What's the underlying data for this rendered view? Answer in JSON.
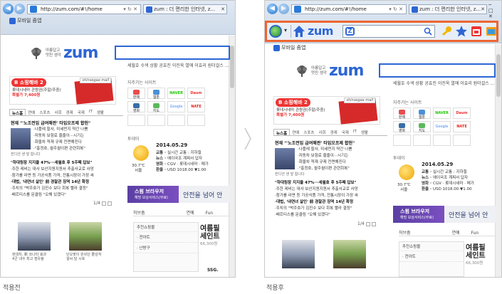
{
  "arrow_icon": "chevron-right-icon",
  "before": {
    "caption": "적용전",
    "address": "http://zum.com/#!/home",
    "tab_title": "zum : 더 편리한 인터넷, z...",
    "window_controls": "─ □ ✕",
    "favorites_link": "모바일 줌앱"
  },
  "after": {
    "caption": "적용후",
    "address": "http://zum.com/#!/home",
    "tab_title": "zum : 더 편리한 인터넷, z...",
    "window_controls": "─ □ ✕",
    "favorites_link": "모바일 줌앱",
    "toolbar": {
      "logo": "zum",
      "search_placeholder": "",
      "icons": [
        "ie-icon",
        "home-icon",
        "key-icon",
        "star-icon",
        "calendar-icon",
        "window-icon"
      ]
    }
  },
  "page": {
    "mobile_link": "모바일 줌앱",
    "slogan_line1": "아름답고",
    "slogan_line2": "멋진 생각",
    "logo": "zum",
    "hot_keywords": "세월호 수색 상황     공효진 이진욱 열애   이효리 원더걸스 ...",
    "ad": {
      "title": "B 소핑해바 2",
      "line1": "롯데시네마 관람권(주말/주중)",
      "line2": "특별가",
      "price": "7,400원",
      "mall": "shinsegae mall"
    },
    "news_tabs": [
      "뉴스홈",
      "연예",
      "스포츠",
      "사회",
      "경제",
      "국제",
      "IT",
      "생활"
    ],
    "news_headline": "현재 \"'노조전임 급여해판' 타임오프제 합헌\"",
    "news_list": [
      "·나플레 할사, 미세먼지 약간 나쁨",
      "·자동차 보험료 줄줄이···시기는",
      "·화물차 적재 규제 전면해진다",
      "·\"홍정호, 월주월이편 관련회복\""
    ],
    "thumb_caption": "컨디션 생 앞 합니다",
    "news_list2": [
      "\"하대링장 지지율 47%···세월호 후 5주째 답보\"",
      "·주한 레비는 대사 보산지원지원서 추출사교로 사망",
      "·참가를 라면 등 가공식품 가격, 전통시장이 가장 싸",
      "·대법, '내연녀 살인' 前 경찰관 징역 14년 확정",
      "·주치의 \"박주호가 김진수 보다 회복 빨라 결정\"",
      "·배르티스를 문클림 \"오해 있겠다\""
    ],
    "news_list2_bold_index": [
      0,
      3
    ],
    "pager": "1/4",
    "photos": [
      {
        "caption1": "현대차, 新 쏘나타 효과",
        "caption2": "4군 내수 최고 점유율"
      },
      {
        "caption1": "단오맞이 원쉬던 줄넘쳐",
        "caption2": "설씨 달 시로"
      }
    ],
    "sites_title": "자주가는 사이트",
    "sites": [
      "판매",
      "웹툰",
      "NAVER",
      "Daum",
      "영화",
      "지도",
      "Google",
      "NATE",
      "",
      "",
      "",
      ""
    ],
    "weather_title": "투데이",
    "weather": {
      "date": "2014.05.29",
      "line1_label": "교통 · ",
      "line1_value": "실시간 교통 : 지하철",
      "line2_label": "뉴스 · ",
      "line2_value": "에이국조 계찌서 답자",
      "line3_label": "영화 · ",
      "line3_value": "CGV · 롯데시네마 · 메가",
      "line4_label": "환율 · ",
      "line4_value": "USD 1018.00 ▼1.00",
      "temp": "30.7℃",
      "city": "서울"
    },
    "banner_title": "스윔 브라우저",
    "banner_sub": "해빙 보상서비스(무료)",
    "banner2_text": "안전을 넘어 안",
    "shop_tabs": [
      "허브줌",
      "연예",
      "Fun"
    ],
    "shop_title": "추천쇼핑몰",
    "shop_rows": [
      "· 전아트",
      "· 난방구"
    ],
    "promo_line1": "여름필",
    "promo_line2": "세인트",
    "promo_price": "66,300원",
    "ssg": "SSG."
  }
}
